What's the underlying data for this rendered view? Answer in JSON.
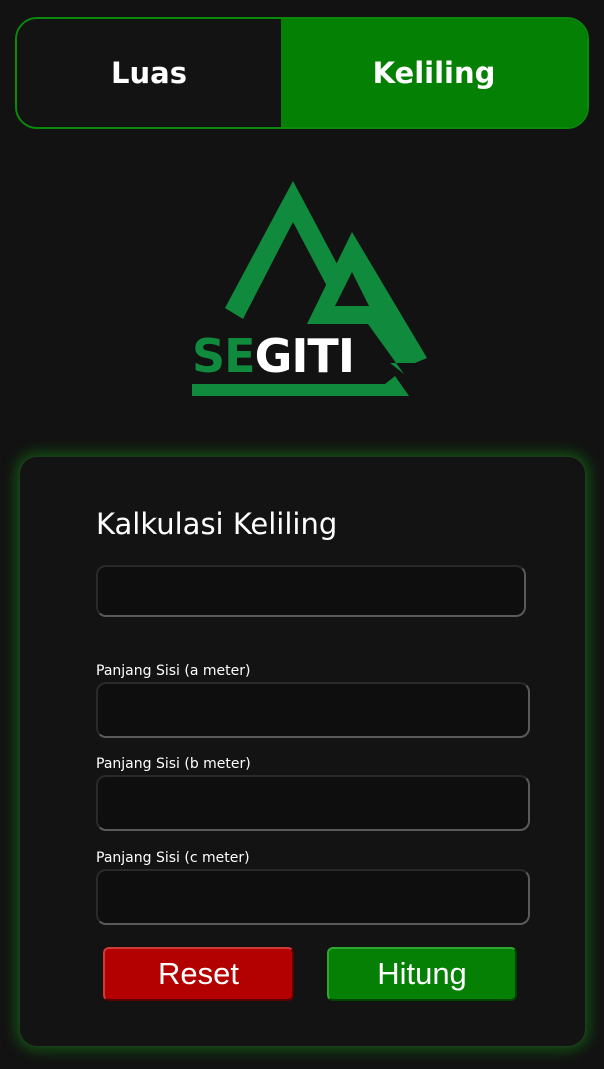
{
  "tabs": [
    {
      "label": "Luas",
      "active": false
    },
    {
      "label": "Keliling",
      "active": true
    }
  ],
  "logo": {
    "text_part1": "SE",
    "text_part2": "GITI",
    "color_green": "#108a3c",
    "color_white": "#ffffff"
  },
  "card": {
    "title": "Kalkulasi Keliling",
    "result_field": {
      "value": "",
      "placeholder": ""
    },
    "fields": [
      {
        "label": "Panjang Sisi (a meter)",
        "value": "",
        "placeholder": ""
      },
      {
        "label": "Panjang Sisi (b meter)",
        "value": "",
        "placeholder": ""
      },
      {
        "label": "Panjang Sisi (c meter)",
        "value": "",
        "placeholder": ""
      }
    ],
    "reset_label": "Reset",
    "submit_label": "Hitung"
  },
  "colors": {
    "background": "#121212",
    "accent_green": "#048004",
    "reset_red": "#b30000",
    "glow_green": "#148c14"
  }
}
